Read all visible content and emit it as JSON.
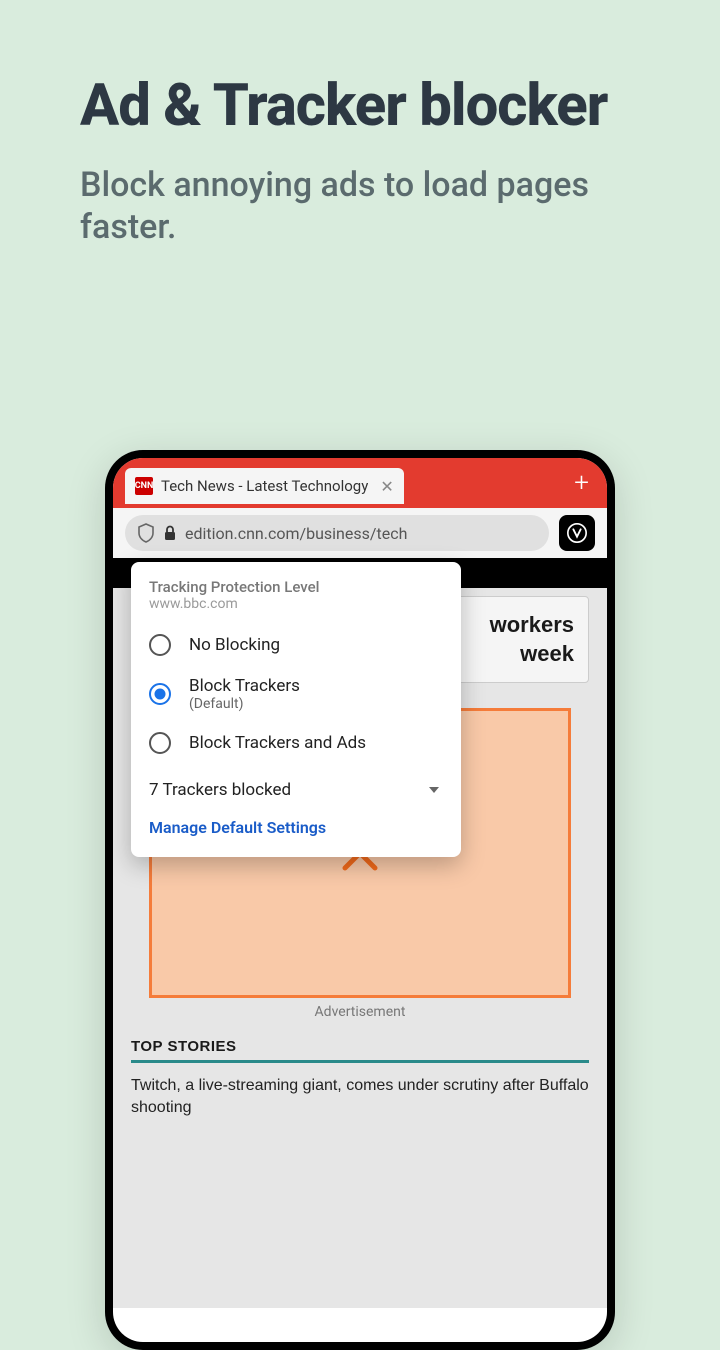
{
  "hero": {
    "title": "Ad & Tracker blocker",
    "subtitle": "Block annoying ads to load pages faster."
  },
  "browser": {
    "tab": {
      "favicon_text": "CNN",
      "title": "Tech News - Latest Technology"
    },
    "url": "edition.cnn.com/business/tech"
  },
  "popup": {
    "title": "Tracking Protection Level",
    "domain": "www.bbc.com",
    "options": [
      {
        "label": "No Blocking",
        "sub": "",
        "selected": false
      },
      {
        "label": "Block Trackers",
        "sub": "(Default)",
        "selected": true
      },
      {
        "label": "Block Trackers and Ads",
        "sub": "",
        "selected": false
      }
    ],
    "trackers_blocked": "7 Trackers blocked",
    "manage_link": "Manage Default Settings"
  },
  "page": {
    "headline_line1": "workers",
    "headline_line2": "week",
    "ad_label": "Advertisement",
    "top_stories": "TOP STORIES",
    "story": "Twitch, a live-streaming giant, comes under scrutiny after Buffalo shooting"
  }
}
